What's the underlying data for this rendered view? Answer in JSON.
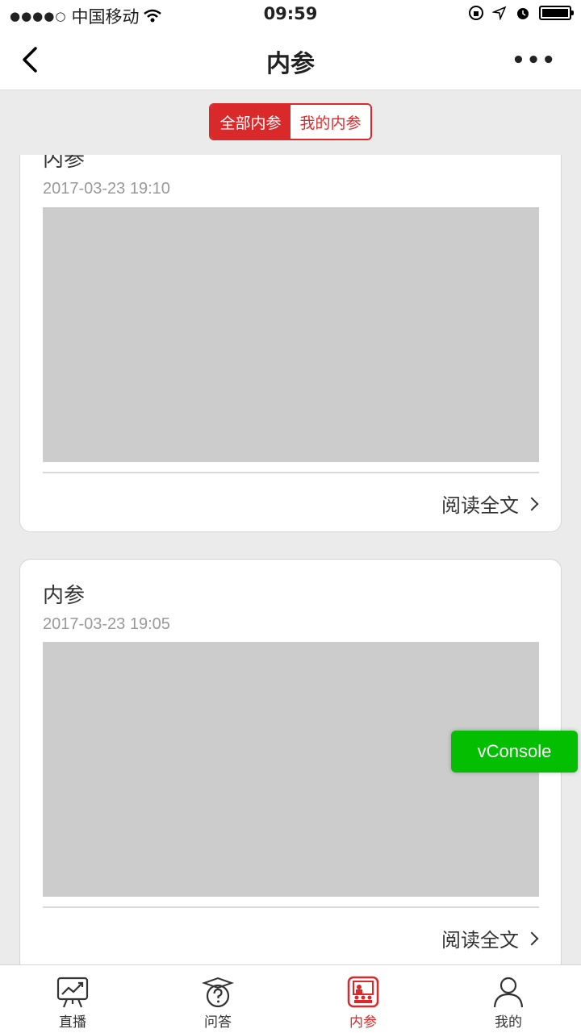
{
  "status_bar": {
    "signal": "●●●●○",
    "carrier": "中国移动",
    "time": "09:59"
  },
  "nav": {
    "title": "内参",
    "more": "•••"
  },
  "segment": {
    "all": "全部内参",
    "mine": "我的内参"
  },
  "cards": [
    {
      "title": "内参",
      "time": "2017-03-23 19:10",
      "read_more": "阅读全文"
    },
    {
      "title": "内参",
      "time": "2017-03-23 19:05",
      "read_more": "阅读全文"
    }
  ],
  "vconsole": {
    "label": "vConsole"
  },
  "tabbar": [
    {
      "label": "直播",
      "icon": "chart-board-icon",
      "active": false
    },
    {
      "label": "问答",
      "icon": "graduation-question-icon",
      "active": false
    },
    {
      "label": "内参",
      "icon": "classroom-icon",
      "active": true
    },
    {
      "label": "我的",
      "icon": "person-icon",
      "active": false
    }
  ],
  "colors": {
    "accent": "#d9292b",
    "vconsole": "#04be02",
    "placeholder": "#cccccc",
    "background": "#ebebeb"
  }
}
